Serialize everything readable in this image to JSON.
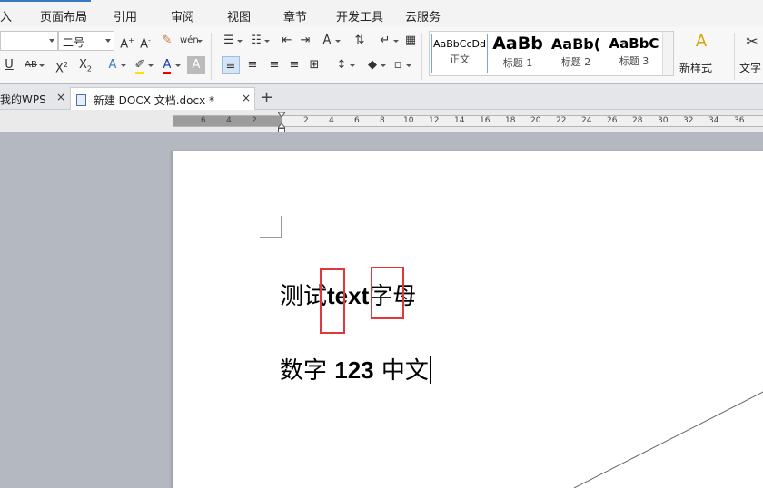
{
  "menu": {
    "items": [
      "入",
      "页面布局",
      "引用",
      "审阅",
      "视图",
      "章节",
      "开发工具",
      "云服务"
    ]
  },
  "toolbar": {
    "font_size_value": "二号",
    "font_name_value": "",
    "style_gallery": [
      {
        "sample": "AaBbCcDd",
        "name": "正文"
      },
      {
        "sample": "AaBb",
        "name": "标题 1"
      },
      {
        "sample": "AaBb(",
        "name": "标题 2"
      },
      {
        "sample": "AaBbC",
        "name": "标题 3"
      }
    ],
    "new_style_label": "新样式",
    "text_tools_label": "文字"
  },
  "tabs": {
    "home_tab": "我的WPS",
    "doc_tab": "新建 DOCX 文档.docx *",
    "close_glyph": "×",
    "new_tab_glyph": "+"
  },
  "ruler": {
    "numbers": [
      "6",
      "4",
      "2",
      "2",
      "4",
      "6",
      "8",
      "10",
      "12",
      "14",
      "16",
      "18",
      "20",
      "22",
      "24",
      "26",
      "28",
      "30",
      "32",
      "34",
      "36"
    ]
  },
  "document": {
    "line1_a": "测试",
    "line1_b": "text",
    "line1_c": "字母",
    "line2_a": "数字 ",
    "line2_b": "123",
    "line2_c": " 中文"
  },
  "colors": {
    "highlight_box": "#e0383a",
    "menu_active": "#3a78c2"
  }
}
